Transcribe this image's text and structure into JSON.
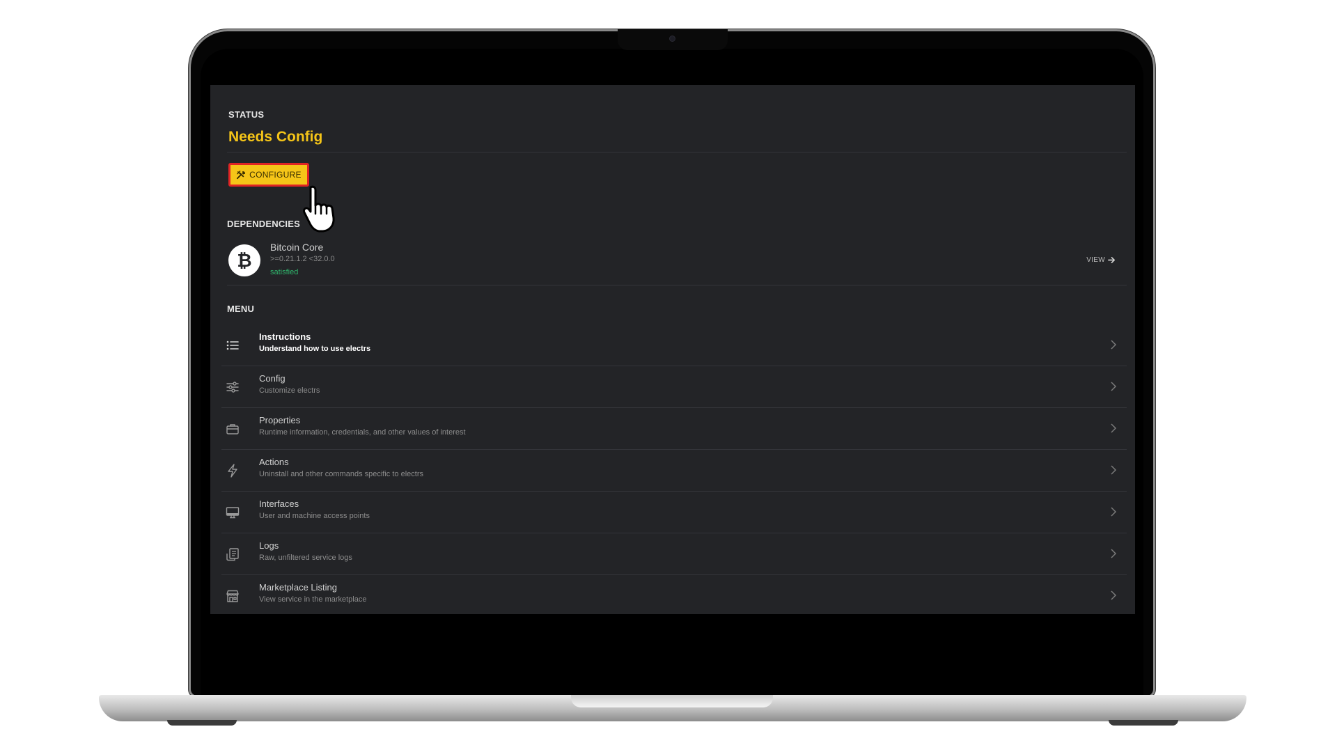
{
  "status": {
    "section_label": "STATUS",
    "value": "Needs Config",
    "value_color": "#f5c518"
  },
  "configure_button": {
    "label": "CONFIGURE",
    "icon": "tools-icon",
    "background": "#f5c518",
    "highlight_border": "#e02424"
  },
  "dependencies": {
    "section_label": "DEPENDENCIES",
    "items": [
      {
        "icon": "bitcoin-icon",
        "name": "Bitcoin Core",
        "version": ">=0.21.1.2 <32.0.0",
        "status": "satisfied",
        "status_color": "#2fb36b",
        "view_label": "VIEW"
      }
    ]
  },
  "menu": {
    "section_label": "MENU",
    "items": [
      {
        "icon": "list-icon",
        "title": "Instructions",
        "description": "Understand how to use electrs",
        "active": true
      },
      {
        "icon": "sliders-icon",
        "title": "Config",
        "description": "Customize electrs",
        "active": false
      },
      {
        "icon": "briefcase-icon",
        "title": "Properties",
        "description": "Runtime information, credentials, and other values of interest",
        "active": false
      },
      {
        "icon": "flash-icon",
        "title": "Actions",
        "description": "Uninstall and other commands specific to electrs",
        "active": false
      },
      {
        "icon": "desktop-icon",
        "title": "Interfaces",
        "description": "User and machine access points",
        "active": false
      },
      {
        "icon": "receipt-icon",
        "title": "Logs",
        "description": "Raw, unfiltered service logs",
        "active": false
      },
      {
        "icon": "storefront-icon",
        "title": "Marketplace Listing",
        "description": "View service in the marketplace",
        "active": false
      }
    ]
  }
}
